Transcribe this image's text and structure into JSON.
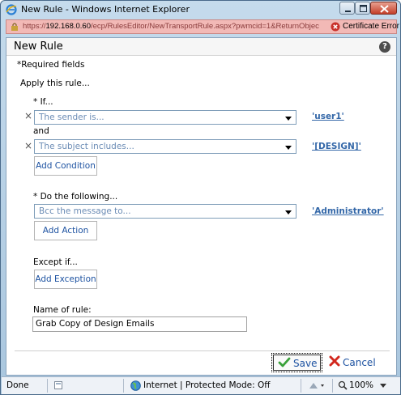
{
  "window": {
    "title": "New Rule - Windows Internet Explorer",
    "url_prefix": "https://",
    "url_host": "192.168.0.60",
    "url_path": "/ecp/RulesEditor/NewTransportRule.aspx?pwmcid=1&ReturnObjec",
    "cert_error": "Certificate Error"
  },
  "page": {
    "title": "New Rule",
    "help": "?",
    "required_note": "*Required fields",
    "apply_label": "Apply this rule...",
    "if_label": "* If...",
    "condition1": {
      "select": "The sender is...",
      "value": "'user1'"
    },
    "and_label": "and",
    "condition2": {
      "select": "The subject includes...",
      "value": "'[DESIGN]'"
    },
    "add_condition": "Add Condition",
    "do_label": "* Do the following...",
    "action1": {
      "select": "Bcc the message to...",
      "value": "'Administrator'"
    },
    "add_action": "Add Action",
    "except_label": "Except if...",
    "add_exception": "Add Exception",
    "name_label": "Name of rule:",
    "name_value": "Grab Copy of Design Emails",
    "remove_glyph": "×",
    "save": "Save",
    "cancel": "Cancel"
  },
  "status": {
    "done": "Done",
    "zone": "Internet | Protected Mode: Off",
    "zoom": "100%"
  },
  "colors": {
    "link": "#3367a8",
    "cert_bar": "#f2b9b6",
    "placeholder": "#6b8cb5"
  }
}
